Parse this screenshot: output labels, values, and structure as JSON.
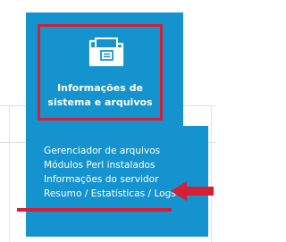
{
  "tile": {
    "icon": "folder-document-icon",
    "label_line1": "Informações de",
    "label_line2": "sistema e arquivos"
  },
  "menu": {
    "items": [
      {
        "label": "Gerenciador de arquivos"
      },
      {
        "label": "Módulos Perl instalados"
      },
      {
        "label": "Informações do servidor"
      },
      {
        "label": "Resumo / Estatísticas / Logs"
      }
    ]
  },
  "colors": {
    "tile_blue": "#1493cf",
    "highlight_red": "#d41f34",
    "text_white": "#ffffff"
  }
}
